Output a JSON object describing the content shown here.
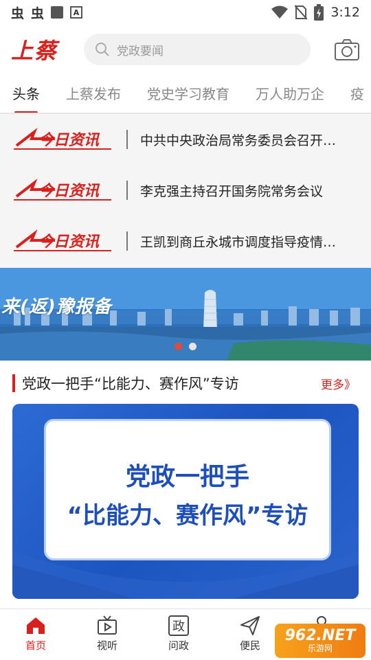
{
  "status_bar": {
    "left_glyphs": [
      "虫",
      "虫"
    ],
    "time": "3:12"
  },
  "header": {
    "logo_text": "上蔡",
    "search_placeholder": "党政要闻",
    "camera_icon": "camera-icon"
  },
  "tabs": [
    {
      "label": "头条",
      "active": true
    },
    {
      "label": "上蔡发布"
    },
    {
      "label": "党史学习教育"
    },
    {
      "label": "万人助万企"
    },
    {
      "label": "疫"
    }
  ],
  "news": [
    {
      "source": "今日资讯",
      "title": "中共中央政治局常务委员会召开…"
    },
    {
      "source": "今日资讯",
      "title": "李克强主持召开国务院常务会议"
    },
    {
      "source": "今日资讯",
      "title": "王凯到商丘永城市调度指导疫情…"
    }
  ],
  "banner": {
    "caption": "来(返)豫报备",
    "active_index": 0,
    "count": 2,
    "dot_active_color": "#e24a3c"
  },
  "section": {
    "title": "党政一把手“比能力、赛作风”专访",
    "more": "更多》"
  },
  "feature": {
    "line1": "党政一把手",
    "line2": "“比能力、赛作风”专访"
  },
  "bottom_nav": [
    {
      "label": "首页",
      "icon": "home-icon",
      "active": true
    },
    {
      "label": "视听",
      "icon": "tv-icon"
    },
    {
      "label": "问政",
      "icon": "zheng-icon",
      "glyph": "政"
    },
    {
      "label": "便民",
      "icon": "send-icon"
    }
  ],
  "watermark": {
    "top": "962.NET",
    "bottom": "乐游网"
  },
  "colors": {
    "brand_red": "#d8211d",
    "tab_indicator": "#c8201c"
  }
}
